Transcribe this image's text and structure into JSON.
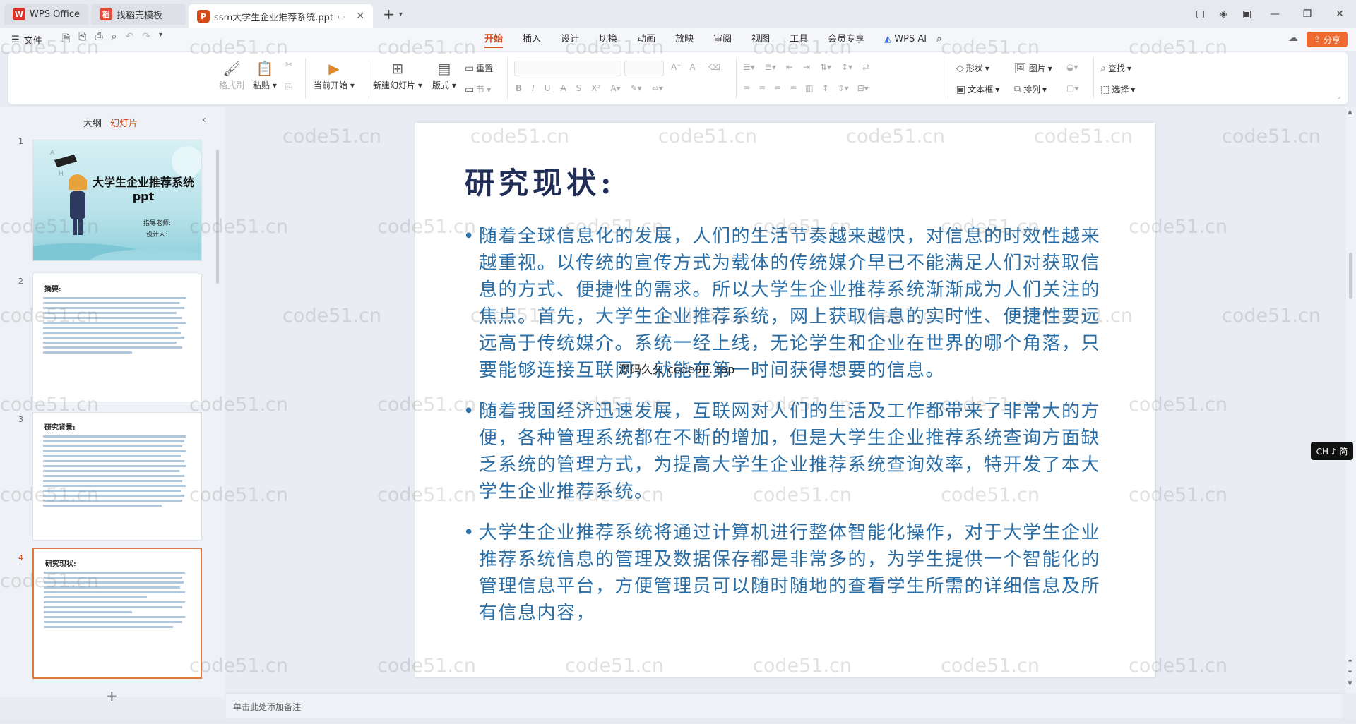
{
  "tabs": [
    {
      "label": "WPS Office",
      "logo": "W",
      "color": "#d8322a"
    },
    {
      "label": "找稻壳模板",
      "logo": "稻",
      "color": "#e74a3b"
    },
    {
      "label": "ssm大学生企业推荐系统.ppt",
      "logo": "P",
      "color": "#d44a1a"
    }
  ],
  "menu": {
    "file_label": "文件",
    "ribbon_tabs": [
      "开始",
      "插入",
      "设计",
      "切换",
      "动画",
      "放映",
      "审阅",
      "视图",
      "工具",
      "会员专享",
      "WPS AI"
    ],
    "active_tab": "开始",
    "share_label": "分享"
  },
  "toolbar": {
    "format_painter": "格式刷",
    "paste": "粘贴",
    "start_from_current": "当前开始",
    "new_slide": "新建幻灯片",
    "layout": "版式",
    "reset": "重置",
    "section": "节",
    "shape": "形状",
    "picture": "图片",
    "textbox": "文本框",
    "arrange": "排列",
    "find": "查找",
    "select": "选择"
  },
  "left_panel": {
    "outline_tab": "大纲",
    "slides_tab": "幻灯片",
    "slide1": {
      "title": "大学生企业推荐系统ppt",
      "teacher": "指导老师:",
      "designer": "设计人:"
    },
    "slide2_title": "摘要:",
    "slide3_title": "研究背景:",
    "slide4_title": "研究现状:",
    "numbers": [
      "1",
      "2",
      "3",
      "4"
    ]
  },
  "slide": {
    "title": "研究现状:",
    "bullets": [
      "随着全球信息化的发展，人们的生活节奏越来越快，对信息的时效性越来越重视。以传统的宣传方式为载体的传统媒介早已不能满足人们对获取信息的方式、便捷性的需求。所以大学生企业推荐系统渐渐成为人们关注的焦点。首先，大学生企业推荐系统，网上获取信息的实时性、便捷性要远远高于传统媒介。系统一经上线，无论学生和企业在世界的哪个角落，只要能够连接互联网，就能在第一时间获得想要的信息。",
      "随着我国经济迅速发展，互联网对人们的生活及工作都带来了非常大的方便，各种管理系统都在不断的增加，但是大学生企业推荐系统查询方面缺乏系统的管理方式，为提高大学生企业推荐系统查询效率，特开发了本大学生企业推荐系统。",
      "大学生企业推荐系统将通过计算机进行整体智能化操作，对于大学生企业推荐系统信息的管理及数据保存都是非常多的，为学生提供一个智能化的管理信息平台，方便管理员可以随时随地的查看学生所需的详细信息及所有信息内容，"
    ],
    "overlay_text": "源码久久 code99. top"
  },
  "notes_placeholder": "单击此处添加备注",
  "ime_label": "CH ♪ 简",
  "watermark": "code51.cn"
}
